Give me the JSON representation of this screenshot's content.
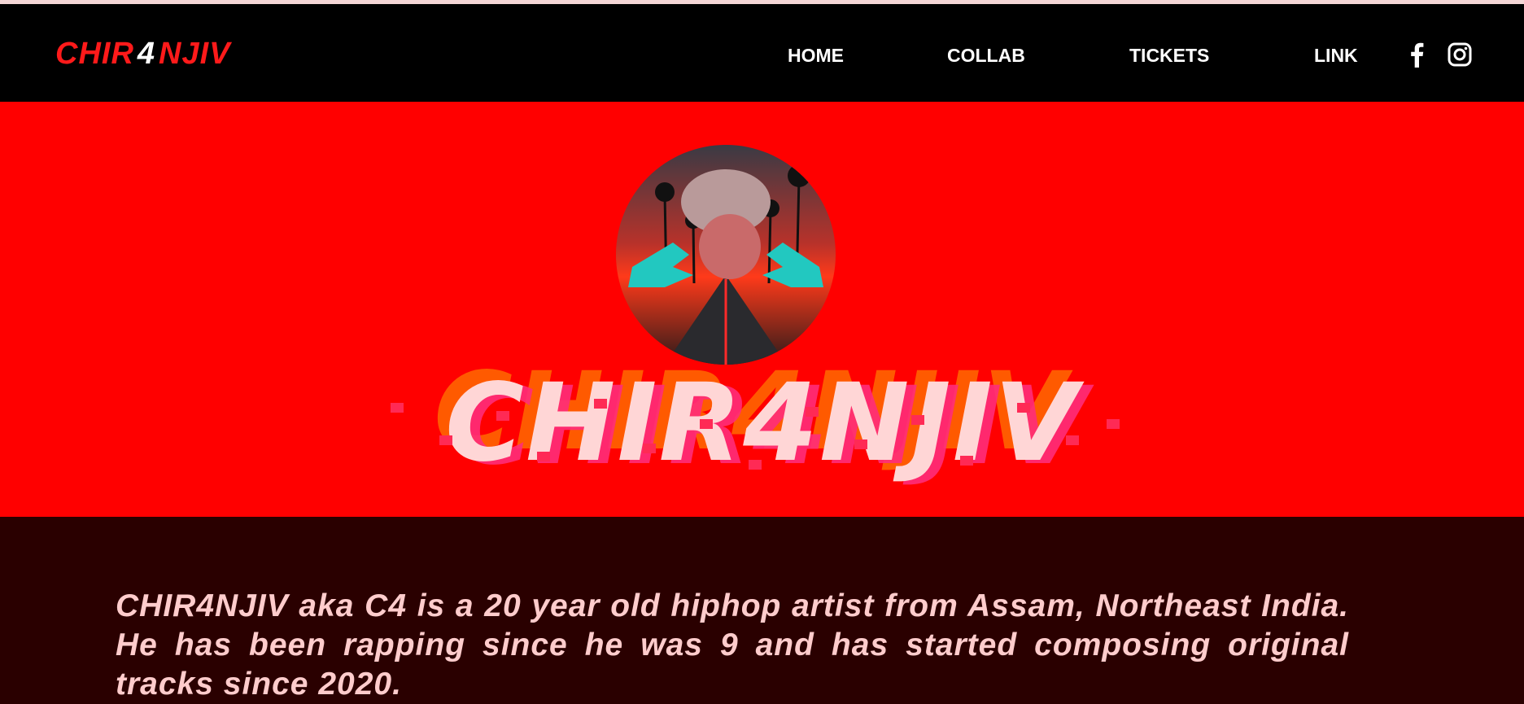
{
  "nav": {
    "logo_left": "CHIR",
    "logo_mid": "4",
    "logo_right": "NJIV",
    "links": [
      {
        "label": "HOME"
      },
      {
        "label": "COLLAB"
      },
      {
        "label": "TICKETS"
      },
      {
        "label": "LINK"
      }
    ],
    "social": [
      {
        "icon": "facebook-icon"
      },
      {
        "icon": "instagram-icon"
      }
    ]
  },
  "hero": {
    "title": "CHIR4NJIV"
  },
  "about": {
    "text": "CHIR4NJIV aka C4 is a 20 year old hiphop artist from Assam, Northeast India. He has been rapping since he was 9 and has started composing original tracks since 2020."
  },
  "colors": {
    "navbar": "#000000",
    "hero_bg": "#ff0000",
    "about_bg": "#2a0000",
    "about_text": "#ffcccc",
    "logo_red": "#ff1a1a"
  }
}
